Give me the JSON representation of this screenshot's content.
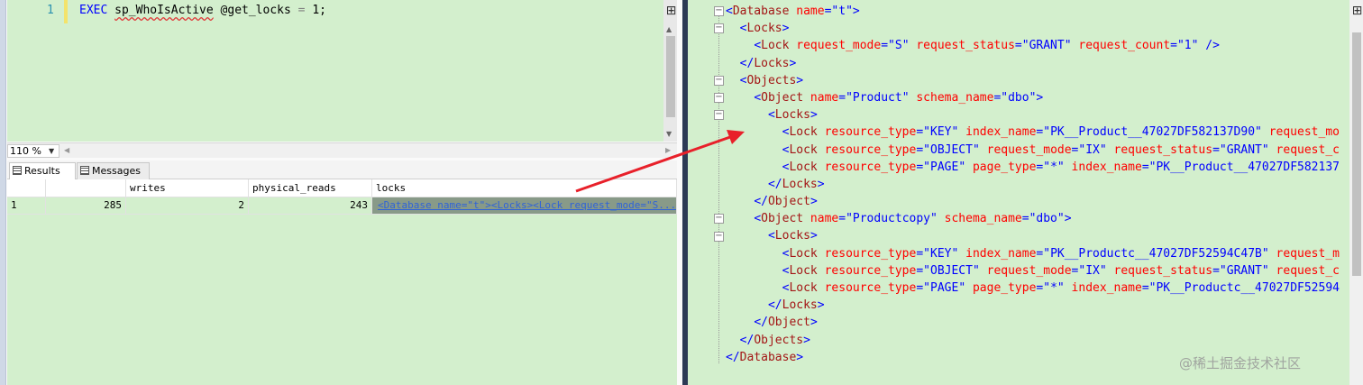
{
  "editor": {
    "line_number": "1",
    "code": {
      "keyword": "EXEC",
      "procedure": "sp_WhoIsActive",
      "parameter": "@get_locks",
      "operator": "=",
      "value": "1;"
    }
  },
  "zoom": {
    "value": "110 %"
  },
  "tabs": {
    "results": "Results",
    "messages": "Messages"
  },
  "grid": {
    "columns": [
      "",
      "",
      "writes",
      "physical_reads",
      "locks"
    ],
    "rows": [
      {
        "row_number": "1",
        "col1": "285",
        "writes": "2",
        "physical_reads": "243",
        "locks": "<Database name=\"t\"><Locks><Lock request_mode=\"S..."
      }
    ]
  },
  "xml_view": {
    "lines": [
      {
        "indent": "",
        "parts": [
          [
            "p",
            "<"
          ],
          [
            "t",
            "Database"
          ],
          [
            "a",
            " name"
          ],
          [
            "p",
            "=\""
          ],
          [
            "v",
            "t"
          ],
          [
            "p",
            "\">"
          ]
        ]
      },
      {
        "indent": "  ",
        "parts": [
          [
            "p",
            "<"
          ],
          [
            "t",
            "Locks"
          ],
          [
            "p",
            ">"
          ]
        ]
      },
      {
        "indent": "    ",
        "parts": [
          [
            "p",
            "<"
          ],
          [
            "t",
            "Lock"
          ],
          [
            "a",
            " request_mode"
          ],
          [
            "p",
            "=\""
          ],
          [
            "v",
            "S"
          ],
          [
            "p",
            "\""
          ],
          [
            "a",
            " request_status"
          ],
          [
            "p",
            "=\""
          ],
          [
            "v",
            "GRANT"
          ],
          [
            "p",
            "\""
          ],
          [
            "a",
            " request_count"
          ],
          [
            "p",
            "=\""
          ],
          [
            "v",
            "1"
          ],
          [
            "p",
            "\" />"
          ]
        ]
      },
      {
        "indent": "  ",
        "parts": [
          [
            "p",
            "</"
          ],
          [
            "t",
            "Locks"
          ],
          [
            "p",
            ">"
          ]
        ]
      },
      {
        "indent": "  ",
        "parts": [
          [
            "p",
            "<"
          ],
          [
            "t",
            "Objects"
          ],
          [
            "p",
            ">"
          ]
        ]
      },
      {
        "indent": "    ",
        "parts": [
          [
            "p",
            "<"
          ],
          [
            "t",
            "Object"
          ],
          [
            "a",
            " name"
          ],
          [
            "p",
            "=\""
          ],
          [
            "v",
            "Product"
          ],
          [
            "p",
            "\""
          ],
          [
            "a",
            " schema_name"
          ],
          [
            "p",
            "=\""
          ],
          [
            "v",
            "dbo"
          ],
          [
            "p",
            "\">"
          ]
        ]
      },
      {
        "indent": "      ",
        "parts": [
          [
            "p",
            "<"
          ],
          [
            "t",
            "Locks"
          ],
          [
            "p",
            ">"
          ]
        ]
      },
      {
        "indent": "        ",
        "parts": [
          [
            "p",
            "<"
          ],
          [
            "t",
            "Lock"
          ],
          [
            "a",
            " resource_type"
          ],
          [
            "p",
            "=\""
          ],
          [
            "v",
            "KEY"
          ],
          [
            "p",
            "\""
          ],
          [
            "a",
            " index_name"
          ],
          [
            "p",
            "=\""
          ],
          [
            "v",
            "PK__Product__47027DF582137D90"
          ],
          [
            "p",
            "\""
          ],
          [
            "a",
            " request_mo"
          ]
        ]
      },
      {
        "indent": "        ",
        "parts": [
          [
            "p",
            "<"
          ],
          [
            "t",
            "Lock"
          ],
          [
            "a",
            " resource_type"
          ],
          [
            "p",
            "=\""
          ],
          [
            "v",
            "OBJECT"
          ],
          [
            "p",
            "\""
          ],
          [
            "a",
            " request_mode"
          ],
          [
            "p",
            "=\""
          ],
          [
            "v",
            "IX"
          ],
          [
            "p",
            "\""
          ],
          [
            "a",
            " request_status"
          ],
          [
            "p",
            "=\""
          ],
          [
            "v",
            "GRANT"
          ],
          [
            "p",
            "\""
          ],
          [
            "a",
            " request_c"
          ]
        ]
      },
      {
        "indent": "        ",
        "parts": [
          [
            "p",
            "<"
          ],
          [
            "t",
            "Lock"
          ],
          [
            "a",
            " resource_type"
          ],
          [
            "p",
            "=\""
          ],
          [
            "v",
            "PAGE"
          ],
          [
            "p",
            "\""
          ],
          [
            "a",
            " page_type"
          ],
          [
            "p",
            "=\""
          ],
          [
            "v",
            "*"
          ],
          [
            "p",
            "\""
          ],
          [
            "a",
            " index_name"
          ],
          [
            "p",
            "=\""
          ],
          [
            "v",
            "PK__Product__47027DF582137"
          ]
        ]
      },
      {
        "indent": "      ",
        "parts": [
          [
            "p",
            "</"
          ],
          [
            "t",
            "Locks"
          ],
          [
            "p",
            ">"
          ]
        ]
      },
      {
        "indent": "    ",
        "parts": [
          [
            "p",
            "</"
          ],
          [
            "t",
            "Object"
          ],
          [
            "p",
            ">"
          ]
        ]
      },
      {
        "indent": "    ",
        "parts": [
          [
            "p",
            "<"
          ],
          [
            "t",
            "Object"
          ],
          [
            "a",
            " name"
          ],
          [
            "p",
            "=\""
          ],
          [
            "v",
            "Productcopy"
          ],
          [
            "p",
            "\""
          ],
          [
            "a",
            " schema_name"
          ],
          [
            "p",
            "=\""
          ],
          [
            "v",
            "dbo"
          ],
          [
            "p",
            "\">"
          ]
        ]
      },
      {
        "indent": "      ",
        "parts": [
          [
            "p",
            "<"
          ],
          [
            "t",
            "Locks"
          ],
          [
            "p",
            ">"
          ]
        ]
      },
      {
        "indent": "        ",
        "parts": [
          [
            "p",
            "<"
          ],
          [
            "t",
            "Lock"
          ],
          [
            "a",
            " resource_type"
          ],
          [
            "p",
            "=\""
          ],
          [
            "v",
            "KEY"
          ],
          [
            "p",
            "\""
          ],
          [
            "a",
            " index_name"
          ],
          [
            "p",
            "=\""
          ],
          [
            "v",
            "PK__Productc__47027DF52594C47B"
          ],
          [
            "p",
            "\""
          ],
          [
            "a",
            " request_m"
          ]
        ]
      },
      {
        "indent": "        ",
        "parts": [
          [
            "p",
            "<"
          ],
          [
            "t",
            "Lock"
          ],
          [
            "a",
            " resource_type"
          ],
          [
            "p",
            "=\""
          ],
          [
            "v",
            "OBJECT"
          ],
          [
            "p",
            "\""
          ],
          [
            "a",
            " request_mode"
          ],
          [
            "p",
            "=\""
          ],
          [
            "v",
            "IX"
          ],
          [
            "p",
            "\""
          ],
          [
            "a",
            " request_status"
          ],
          [
            "p",
            "=\""
          ],
          [
            "v",
            "GRANT"
          ],
          [
            "p",
            "\""
          ],
          [
            "a",
            " request_c"
          ]
        ]
      },
      {
        "indent": "        ",
        "parts": [
          [
            "p",
            "<"
          ],
          [
            "t",
            "Lock"
          ],
          [
            "a",
            " resource_type"
          ],
          [
            "p",
            "=\""
          ],
          [
            "v",
            "PAGE"
          ],
          [
            "p",
            "\""
          ],
          [
            "a",
            " page_type"
          ],
          [
            "p",
            "=\""
          ],
          [
            "v",
            "*"
          ],
          [
            "p",
            "\""
          ],
          [
            "a",
            " index_name"
          ],
          [
            "p",
            "=\""
          ],
          [
            "v",
            "PK__Productc__47027DF52594"
          ]
        ]
      },
      {
        "indent": "      ",
        "parts": [
          [
            "p",
            "</"
          ],
          [
            "t",
            "Locks"
          ],
          [
            "p",
            ">"
          ]
        ]
      },
      {
        "indent": "    ",
        "parts": [
          [
            "p",
            "</"
          ],
          [
            "t",
            "Object"
          ],
          [
            "p",
            ">"
          ]
        ]
      },
      {
        "indent": "  ",
        "parts": [
          [
            "p",
            "</"
          ],
          [
            "t",
            "Objects"
          ],
          [
            "p",
            ">"
          ]
        ]
      },
      {
        "indent": "",
        "parts": [
          [
            "p",
            "</"
          ],
          [
            "t",
            "Database"
          ],
          [
            "p",
            ">"
          ]
        ]
      }
    ]
  },
  "watermark": "@稀土掘金技术社区",
  "colors": {
    "editor_bg": "#d3efcd",
    "keyword": "#0000ff",
    "xml_tag": "#a31515",
    "xml_attr": "#ff0000",
    "xml_value": "#0000ff",
    "arrow": "#e8202a",
    "divider": "#2c3a55"
  }
}
